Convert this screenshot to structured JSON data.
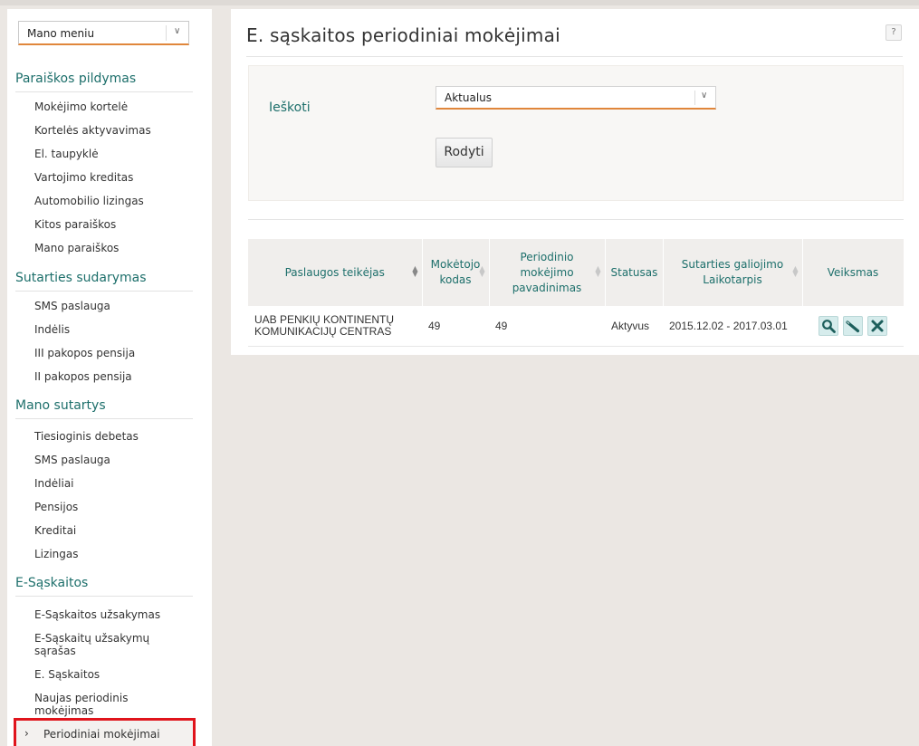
{
  "sidebar": {
    "menu_select": "Mano meniu",
    "sections": [
      {
        "title": "Paraiškos pildymas",
        "items": [
          "Mokėjimo kortelė",
          "Kortelės aktyvavimas",
          "El. taupyklė",
          "Vartojimo kreditas",
          "Automobilio lizingas",
          "Kitos paraiškos",
          "Mano paraiškos"
        ]
      },
      {
        "title": "Sutarties sudarymas",
        "items": [
          "SMS paslauga",
          "Indėlis",
          "III pakopos pensija",
          "II pakopos pensija"
        ]
      },
      {
        "title": "Mano sutartys",
        "items": [
          "Tiesioginis debetas",
          "SMS paslauga",
          "Indėliai",
          "Pensijos",
          "Kreditai",
          "Lizingas"
        ]
      },
      {
        "title": "E-Sąskaitos",
        "items": [
          "E-Sąskaitos užsakymas",
          "E-Sąskaitų užsakymų sąrašas",
          "E. Sąskaitos",
          "Naujas periodinis mokėjimas"
        ]
      }
    ],
    "active_item": "Periodiniai mokėjimai"
  },
  "main": {
    "title": "E. sąskaitos periodiniai mokėjimai",
    "help": "?",
    "filter": {
      "label": "Ieškoti",
      "select_value": "Aktualus",
      "button": "Rodyti"
    },
    "table": {
      "headers": [
        "Paslaugos teikėjas",
        "Mokėtojo kodas",
        "Periodinio mokėjimo pavadinimas",
        "Statusas",
        "Sutarties galiojimo Laikotarpis",
        "Veiksmas"
      ],
      "rows": [
        [
          "UAB PENKIŲ KONTINENTŲ KOMUNIKACIJŲ CENTRAS",
          "49",
          "49",
          "Aktyvus",
          "2015.12.02 - 2017.03.01"
        ]
      ]
    }
  },
  "colors": {
    "accent": "#1d6f6b",
    "underline": "#e0863b",
    "highlight": "#e0141c"
  }
}
